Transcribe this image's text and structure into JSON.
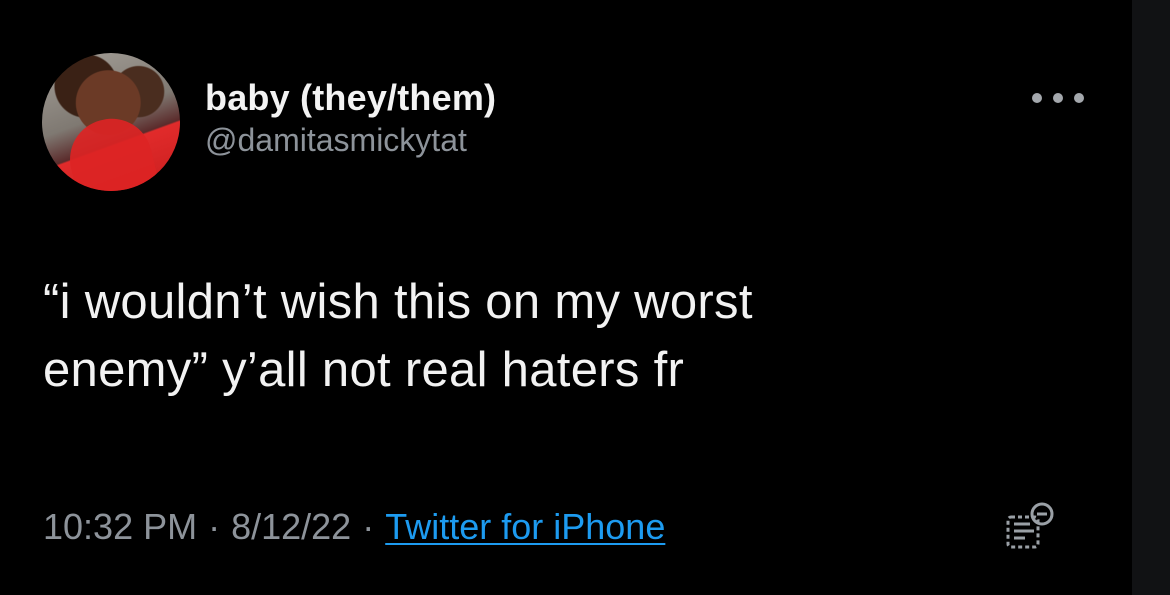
{
  "tweet": {
    "author": {
      "display_name": "baby (they/them)",
      "handle": "@damitasmickytat"
    },
    "text": "“i wouldn’t wish this on my worst\nenemy” y’all not real haters fr",
    "metadata": {
      "time": "10:32 PM",
      "separator": "·",
      "date": "8/12/22",
      "source": "Twitter for iPhone"
    }
  },
  "icons": {
    "more": "more-horizontal-icon",
    "analytics": "tweet-analytics-icon"
  },
  "colors": {
    "background": "#000000",
    "text": "#f2f2f2",
    "muted": "#8d939a",
    "link": "#1d9bf0"
  }
}
